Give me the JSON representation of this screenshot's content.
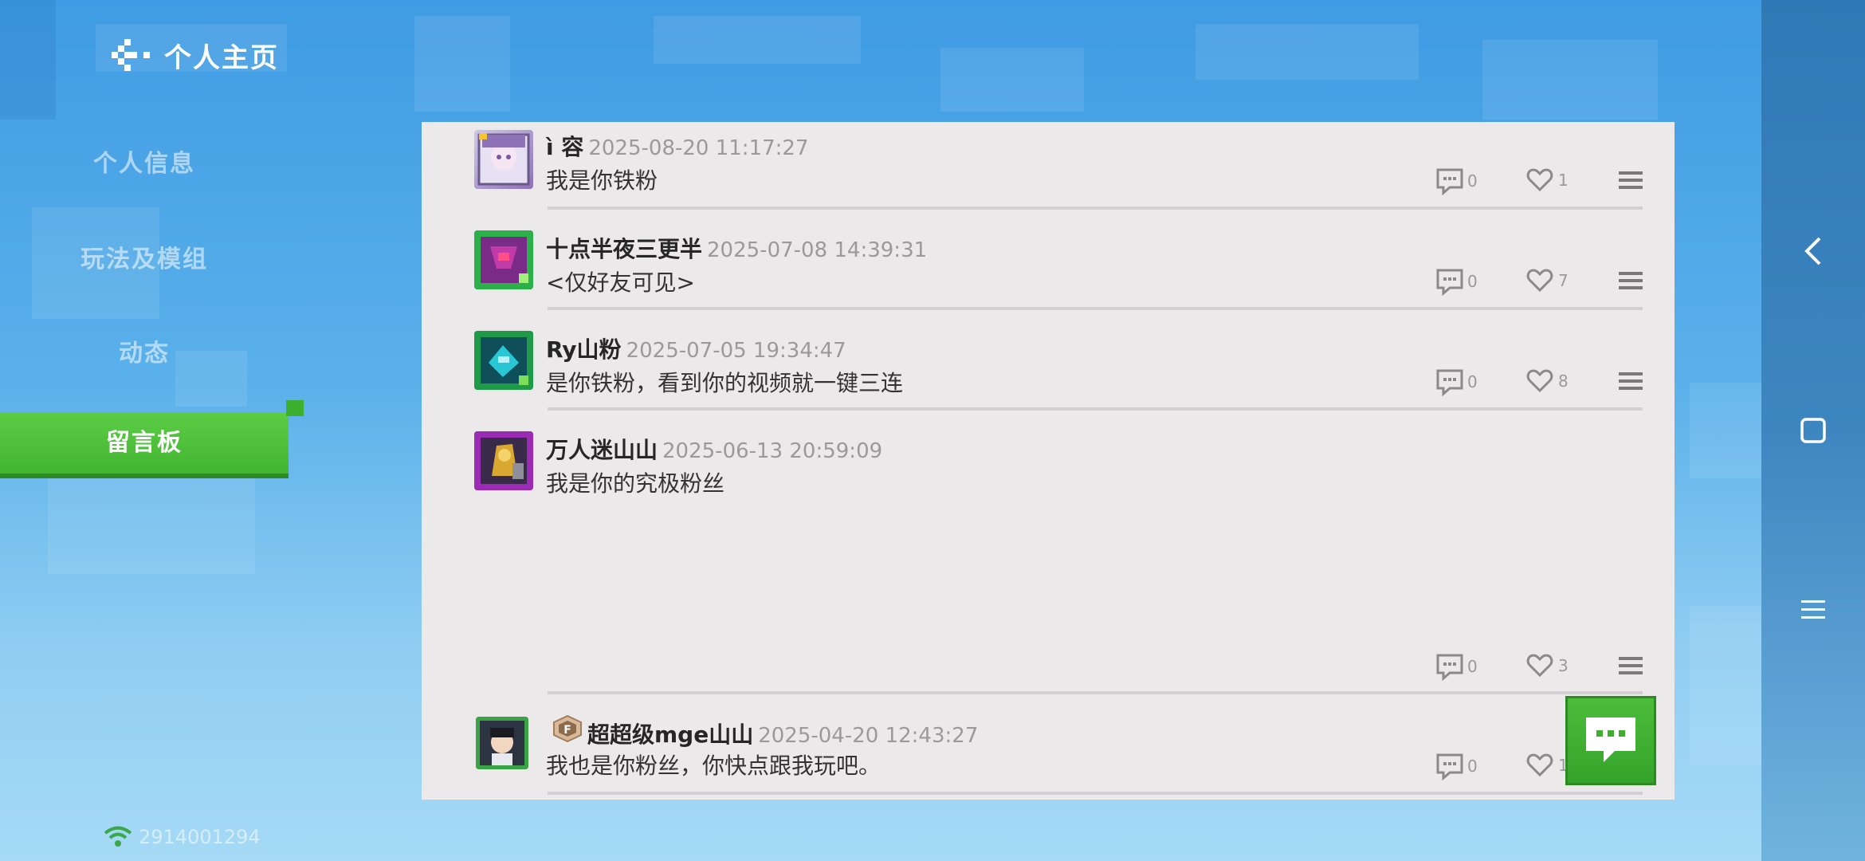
{
  "header": {
    "title": "个人主页"
  },
  "sidebar": {
    "items": [
      {
        "label": "个人信息"
      },
      {
        "label": "玩法及模组"
      },
      {
        "label": "动态"
      },
      {
        "label": "留言板"
      }
    ],
    "active": "留言板"
  },
  "messages": [
    {
      "name": "ì 容",
      "time": "2025-08-20 11:17:27",
      "text": "我是你铁粉",
      "replies": "0",
      "likes": "1",
      "avatar_color": "#8e72b8"
    },
    {
      "name": "十点半夜三更半",
      "time": "2025-07-08 14:39:31",
      "text": "<仅好友可见>",
      "replies": "0",
      "likes": "7",
      "avatar_color": "#2bb04a"
    },
    {
      "name": "Ry山粉",
      "time": "2025-07-05 19:34:47",
      "text": "是你铁粉，看到你的视频就一键三连",
      "replies": "0",
      "likes": "8",
      "avatar_color": "#1f9a49"
    },
    {
      "name": "万人迷山山",
      "time": "2025-06-13 20:59:09",
      "text": "我是你的究极粉丝",
      "replies": "0",
      "likes": "3",
      "avatar_color": "#9b2bb5"
    },
    {
      "name": "超超级mge山山",
      "time": "2025-04-20 12:43:27",
      "text": "我也是你粉丝，你快点跟我玩吧。",
      "replies": "0",
      "likes": "18",
      "avatar_color": "#3aa345",
      "badge": "F"
    }
  ],
  "status": {
    "id_text": "2914001294"
  },
  "colors": {
    "accent_green": "#42b531",
    "panel_bg": "#ece9ea"
  },
  "icons": [
    "back-icon",
    "reply-icon",
    "like-icon",
    "more-menu-icon",
    "message-fab-icon",
    "wifi-icon",
    "nav-back-icon",
    "nav-home-icon",
    "nav-menu-icon"
  ]
}
